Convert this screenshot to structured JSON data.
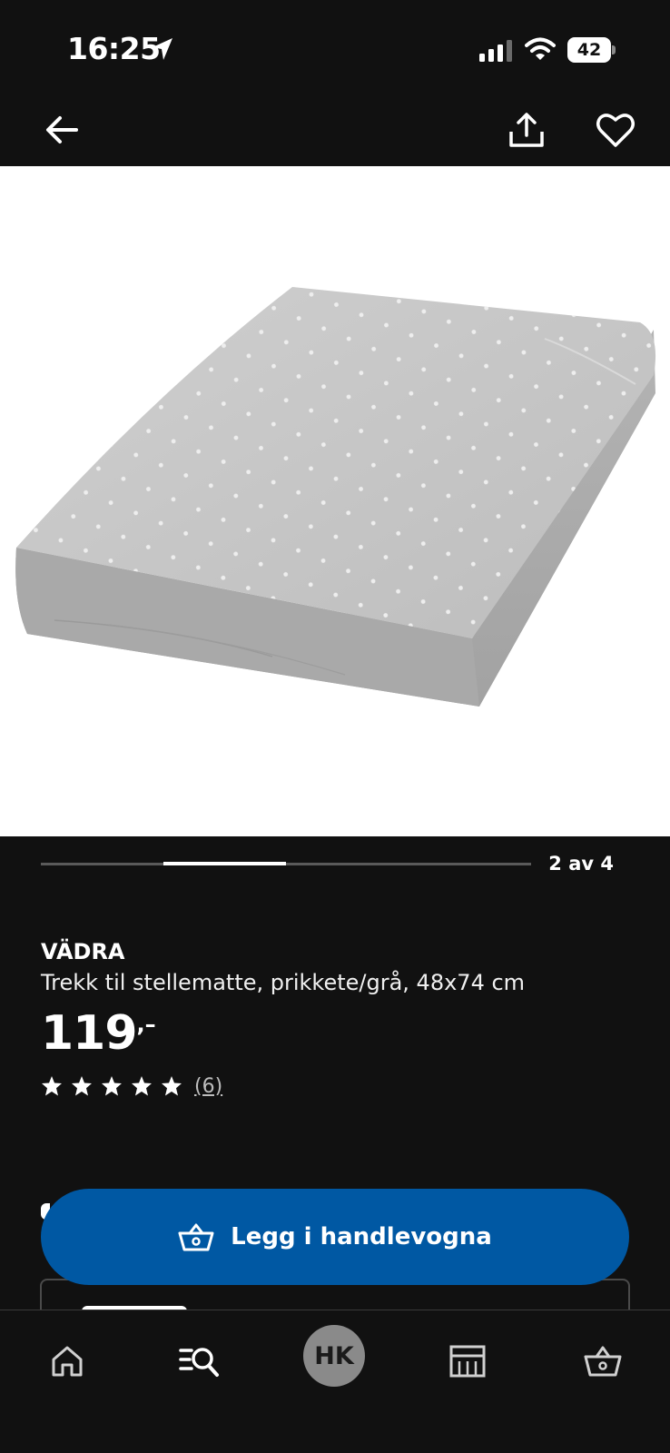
{
  "status_bar": {
    "time": "16:25",
    "battery": "42"
  },
  "carousel": {
    "counter": "2 av 4",
    "current": 2,
    "total": 4
  },
  "product": {
    "name": "VÄDRA",
    "description": "Trekk til stellematte, prikkete/grå, 48x74 cm",
    "price_int": "119",
    "price_suffix": ",–",
    "rating": 5,
    "review_count": "(6)"
  },
  "cart_button": {
    "label": "Legg i handlevogna"
  },
  "bottom_nav": {
    "profile_initials": "HK"
  },
  "colors": {
    "background": "#111111",
    "accent": "#0058a3",
    "text": "#ffffff"
  }
}
